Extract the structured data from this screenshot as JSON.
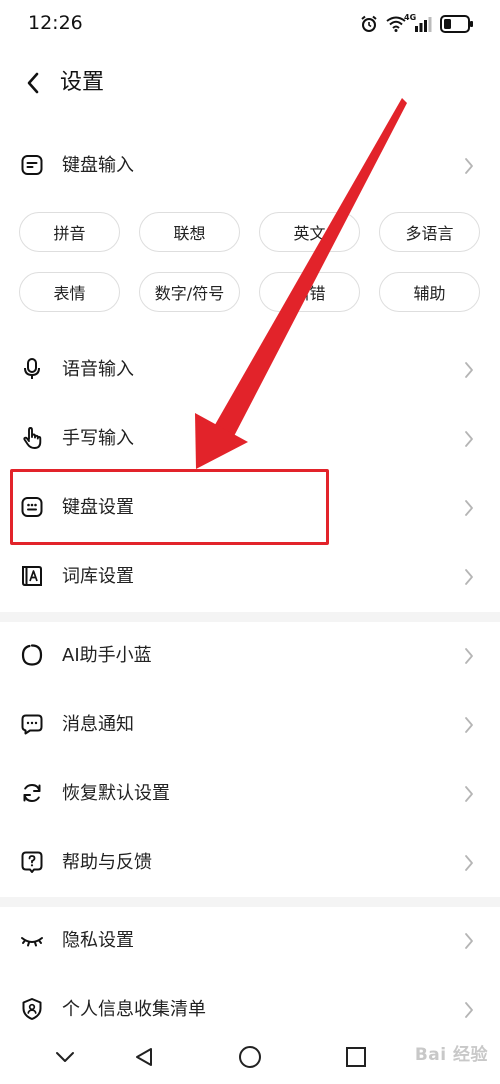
{
  "status_bar": {
    "time": "12:26",
    "network": "4G"
  },
  "header": {
    "title": "设置"
  },
  "keyboard_input": {
    "label": "键盘输入",
    "chips": [
      {
        "label": "拼音"
      },
      {
        "label": "联想"
      },
      {
        "label": "英文"
      },
      {
        "label": "多语言"
      },
      {
        "label": "表情"
      },
      {
        "label": "数字/符号"
      },
      {
        "label": "纠错"
      },
      {
        "label": "辅助"
      }
    ]
  },
  "section1": [
    {
      "label": "语音输入",
      "icon": "microphone-icon"
    },
    {
      "label": "手写输入",
      "icon": "hand-pointer-icon"
    },
    {
      "label": "键盘设置",
      "icon": "keyboard-icon"
    },
    {
      "label": "词库设置",
      "icon": "dictionary-icon"
    }
  ],
  "section2": [
    {
      "label": "AI助手小蓝",
      "icon": "ai-ring-icon"
    },
    {
      "label": "消息通知",
      "icon": "message-icon"
    },
    {
      "label": "恢复默认设置",
      "icon": "refresh-icon"
    },
    {
      "label": "帮助与反馈",
      "icon": "help-icon"
    }
  ],
  "section3": [
    {
      "label": "隐私设置",
      "icon": "eye-closed-icon"
    },
    {
      "label": "个人信息收集清单",
      "icon": "shield-icon"
    }
  ],
  "annotation": {
    "color": "#e2232a"
  },
  "watermark": "Bai 经验"
}
